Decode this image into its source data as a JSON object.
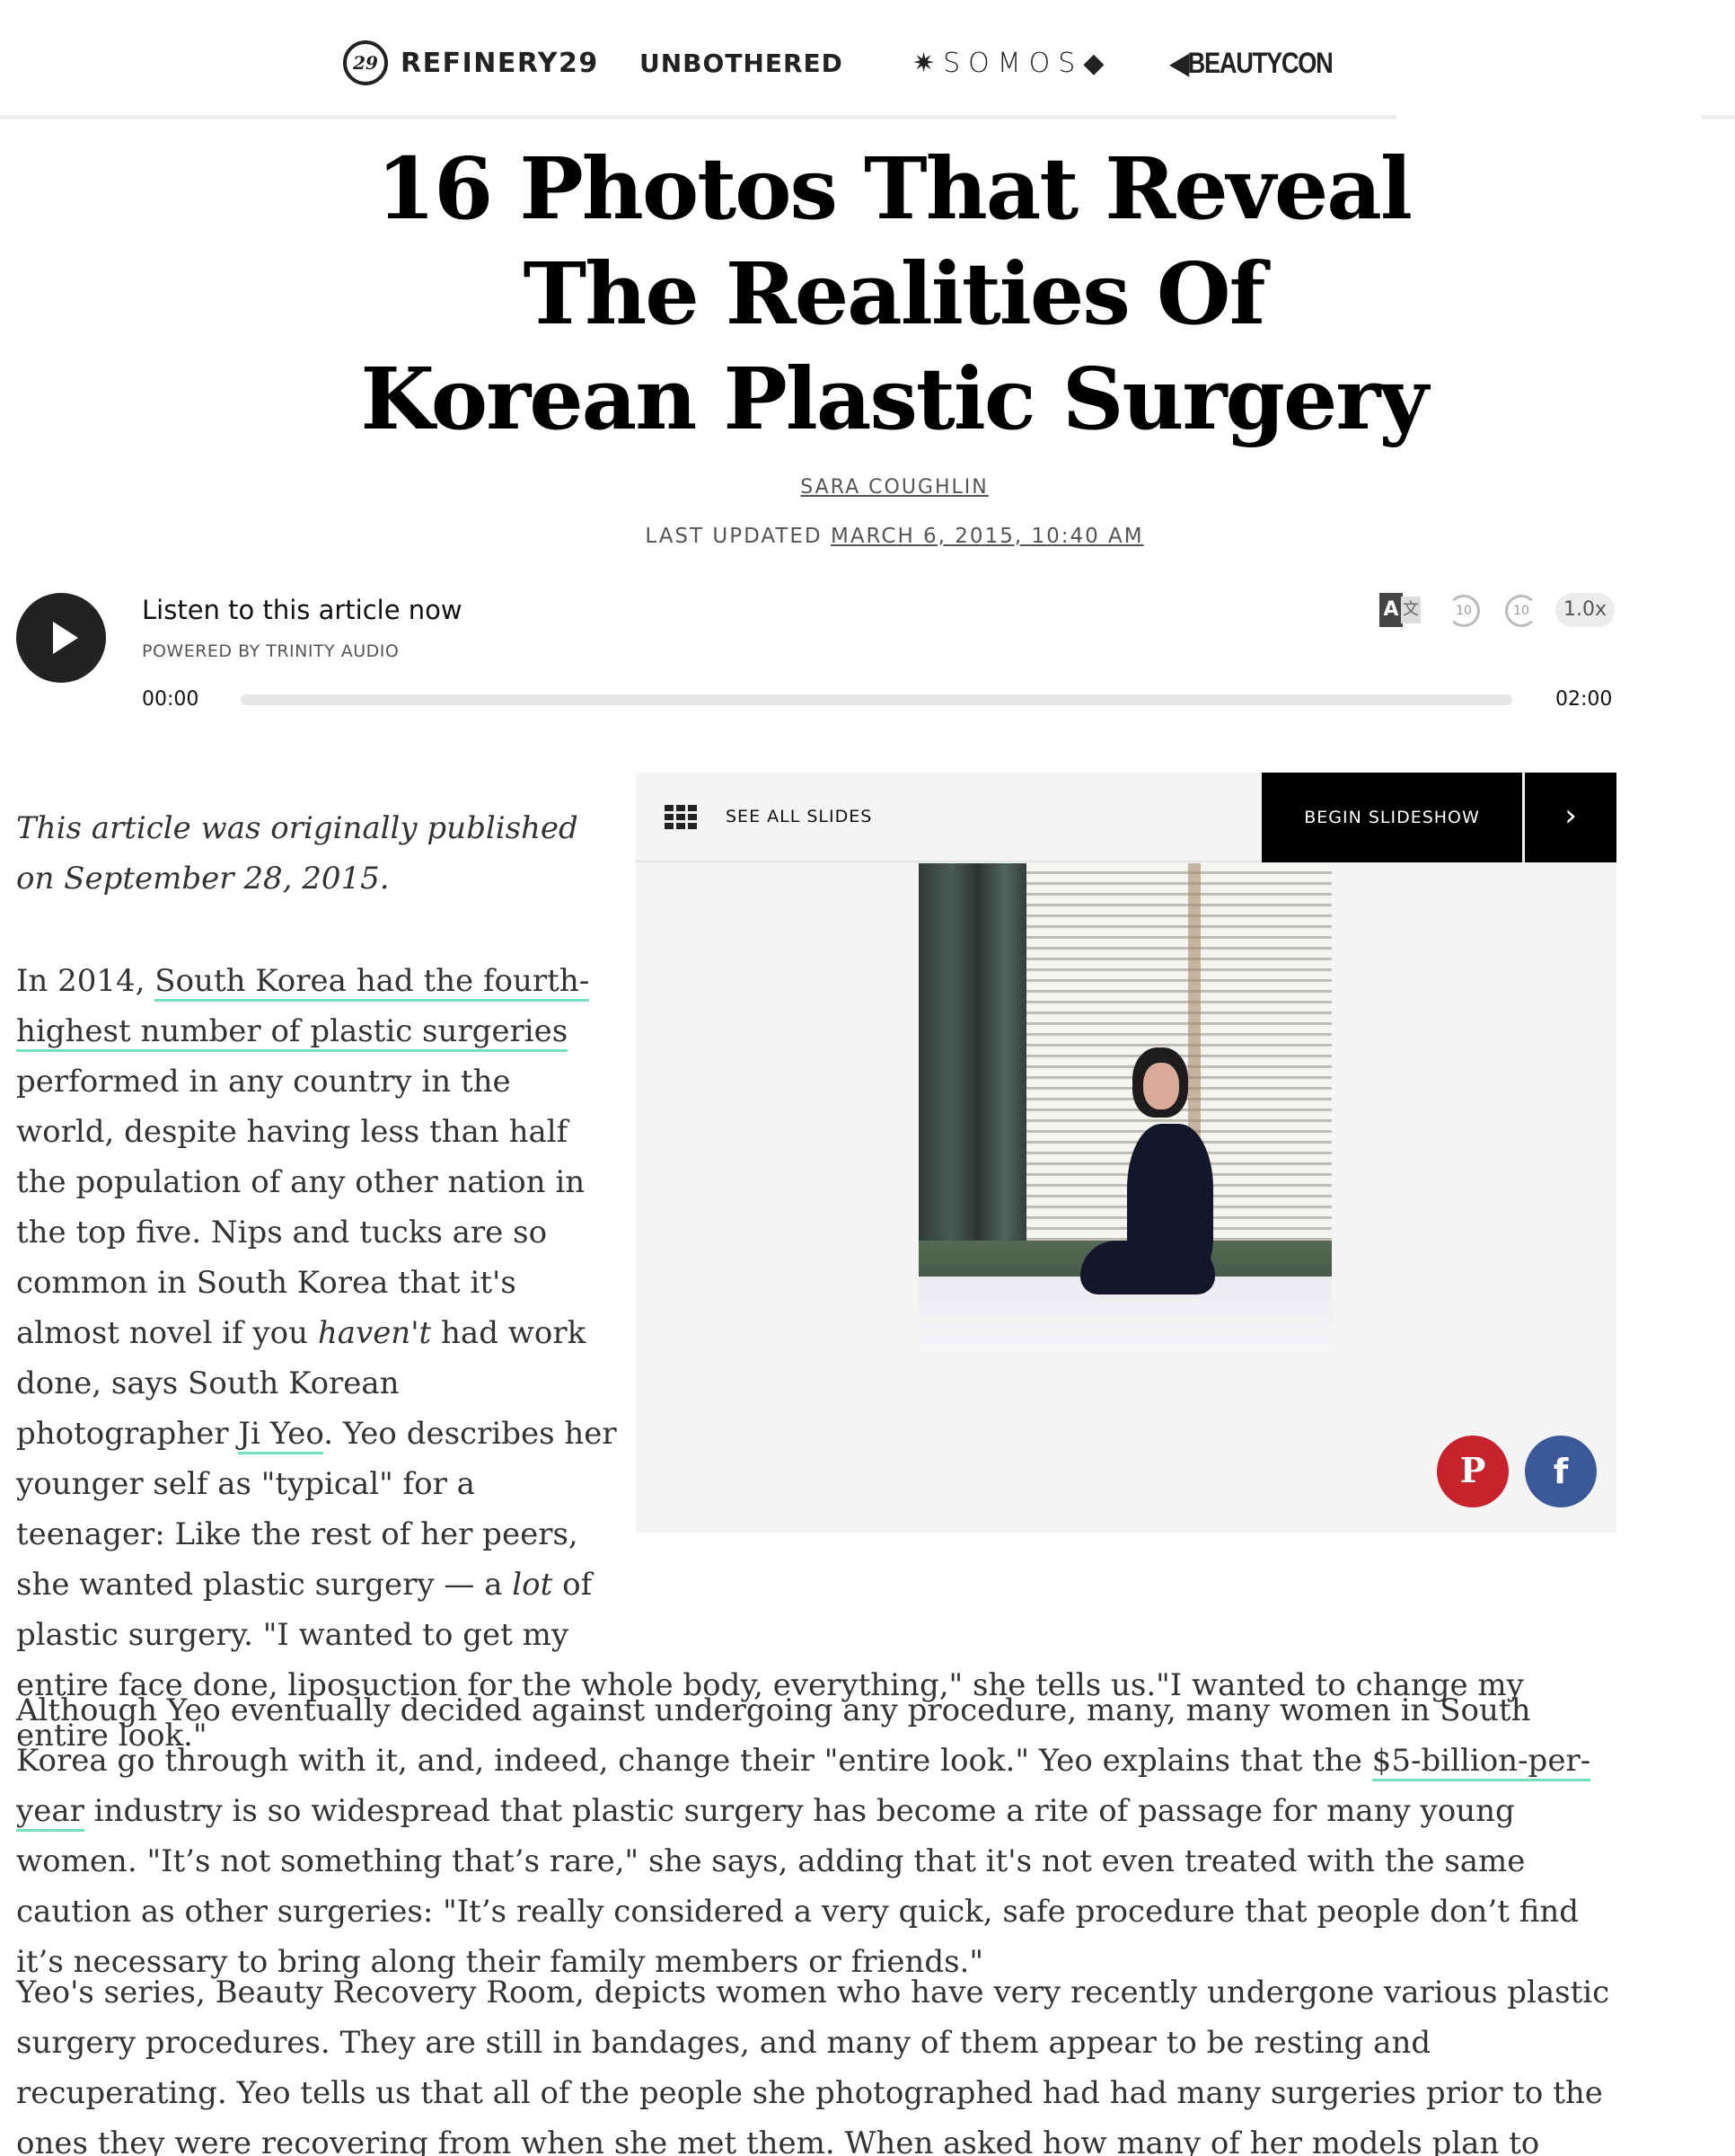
{
  "nav": {
    "brands": [
      {
        "name": "REFINERY29",
        "mark": "29"
      },
      {
        "name": "UNBOTHERED"
      },
      {
        "name": "✷SOMOS◆"
      },
      {
        "name": "◀BEAUTYCON"
      }
    ]
  },
  "article": {
    "title": "16 Photos That Reveal The Realities Of Korean Plastic Surgery",
    "author": "SARA COUGHLIN",
    "updated_prefix": "LAST UPDATED",
    "updated_date": "MARCH 6, 2015, 10:40 AM"
  },
  "audio": {
    "listen_label": "Listen to this article now",
    "powered_by": "POWERED BY  TRINITY AUDIO",
    "time_current": "00:00",
    "time_total": "02:00",
    "progress": 0,
    "skip_back": "10",
    "skip_forward": "10",
    "speed": "1.0x",
    "translate_icon": "translate-icon"
  },
  "slideshow": {
    "see_all": "SEE ALL SLIDES",
    "begin": "BEGIN SLIDESHOW",
    "next_icon": "chevron-right-icon",
    "share": {
      "pinterest": "pinterest-icon",
      "facebook": "facebook-icon"
    }
  },
  "body": {
    "note": "This article was originally published on September 28, 2015.",
    "p1": {
      "t1": "In 2014, ",
      "link1": "South Korea had the fourth-highest number of plastic surgeries",
      "t2": " performed in any country in the world, despite having less than half the population of any other nation in the top five. Nips and tucks are so common in South Korea that it's almost novel if you ",
      "em1": "haven't",
      "t3": " had work done, says South Korean photographer ",
      "link2": "Ji Yeo",
      "t4": ". Yeo describes her younger self as \"typical\" for a teenager: Like the rest of her peers, she wanted plastic surgery — a ",
      "em2": "lot",
      "t5": " of plastic surgery. \"I wanted to get my entire face done, liposuction for the whole body, everything,\" she tells us.\"I wanted to change my entire look.\""
    },
    "p2": {
      "t1": "Although Yeo eventually decided against undergoing any procedure, many, many women in South Korea go through with it, and, indeed, change their \"entire look.\" Yeo explains that the ",
      "link1": "$5-billion-per-year",
      "t2": " industry is so widespread that plastic surgery has become a rite of passage for many young women. \"It’s not something that’s rare,\" she says, adding that it's not even treated with the same caution as other surgeries: \"It’s really considered a very quick, safe procedure that people don’t find it’s necessary to bring along their family members or friends.\""
    },
    "p3": "Yeo's series, Beauty Recovery Room, depicts women who have very recently undergone various plastic surgery procedures. They are still in bandages, and many of them appear to be resting and recuperating. Yeo tells us that all of the people she photographed had had many surgeries prior to the ones they were recovering from when she met them. When asked how many of her models plan to return for even more work in the future, Yeo says, without hesitation,"
  },
  "colors": {
    "link_underline": "#6fe0c0",
    "pinterest": "#c8232c",
    "facebook": "#3b5998"
  }
}
